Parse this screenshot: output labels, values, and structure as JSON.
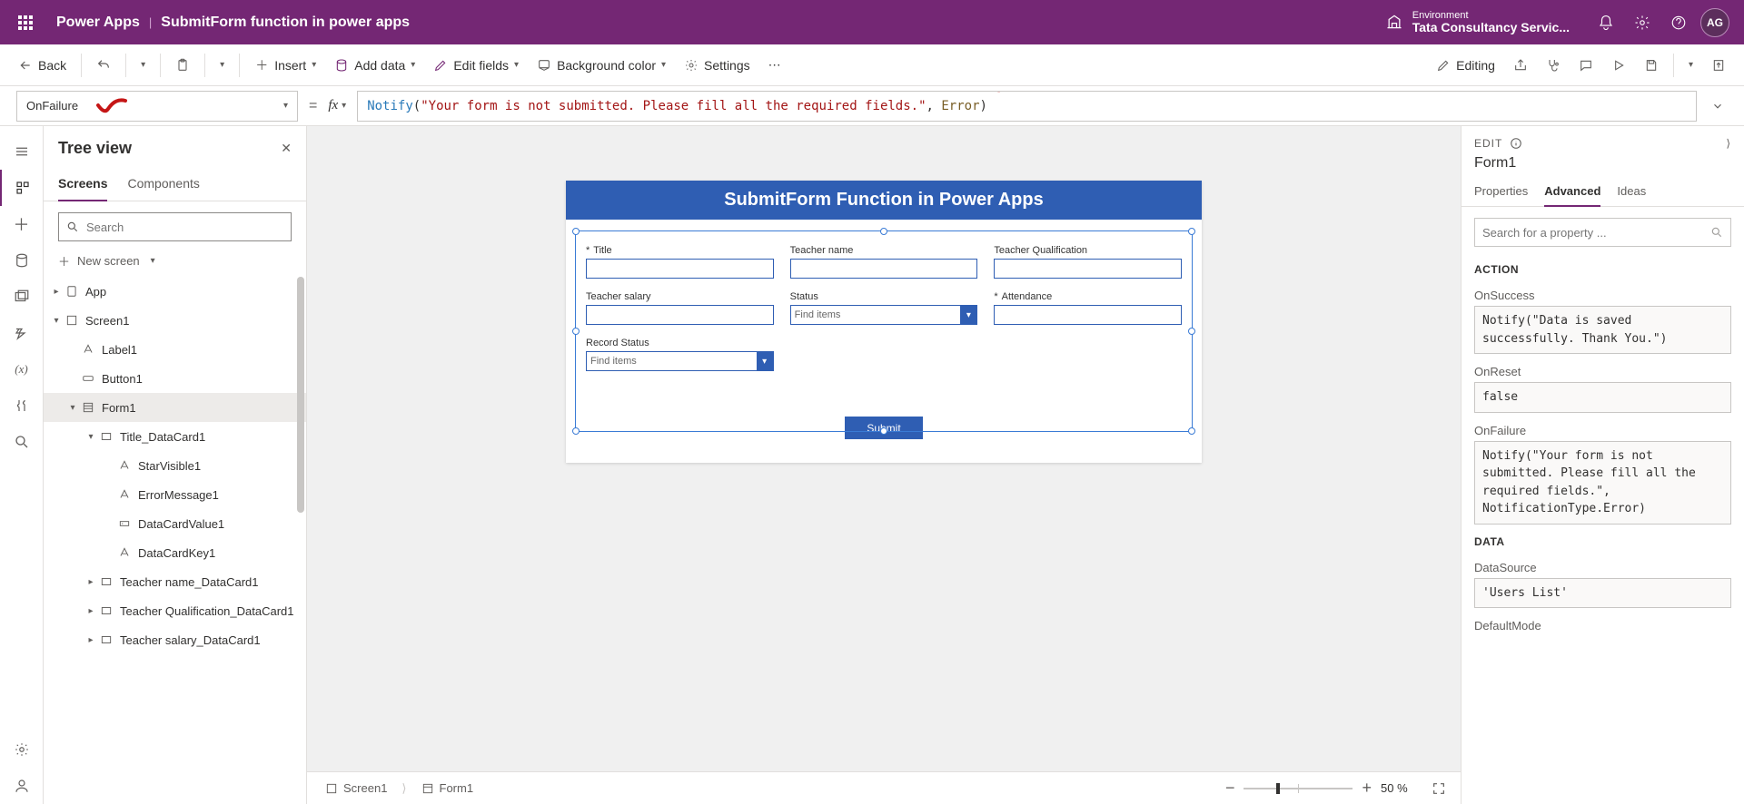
{
  "header": {
    "app": "Power Apps",
    "sep": "|",
    "title": "SubmitForm function in power apps",
    "env_label": "Environment",
    "env_name": "Tata Consultancy Servic...",
    "avatar": "AG"
  },
  "cmdbar": {
    "back": "Back",
    "insert": "Insert",
    "add_data": "Add data",
    "edit_fields": "Edit fields",
    "bg_color": "Background color",
    "settings": "Settings",
    "editing": "Editing"
  },
  "formula": {
    "property": "OnFailure",
    "fn": "Notify",
    "open": "(",
    "str": "\"Your form is not submitted. Please fill all the required fields.\"",
    "comma": ", ",
    "enum": "Error",
    "close": ")"
  },
  "tree": {
    "title": "Tree view",
    "tab_screens": "Screens",
    "tab_components": "Components",
    "search_placeholder": "Search",
    "new_screen": "New screen",
    "items": {
      "app": "App",
      "screen1": "Screen1",
      "label1": "Label1",
      "button1": "Button1",
      "form1": "Form1",
      "title_dc": "Title_DataCard1",
      "starvisible": "StarVisible1",
      "errmsg": "ErrorMessage1",
      "dcval": "DataCardValue1",
      "dckey": "DataCardKey1",
      "teacher_name_dc": "Teacher name_DataCard1",
      "teacher_qual_dc": "Teacher Qualification_DataCard1",
      "teacher_sal_dc": "Teacher salary_DataCard1"
    }
  },
  "canvas": {
    "heading": "SubmitForm Function in Power Apps",
    "fields": {
      "title": "Title",
      "teacher_name": "Teacher name",
      "teacher_qual": "Teacher Qualification",
      "teacher_salary": "Teacher salary",
      "status": "Status",
      "attendance": "Attendance",
      "record_status": "Record Status",
      "find_items": "Find items"
    },
    "submit": "Submit",
    "bc_screen": "Screen1",
    "bc_form": "Form1",
    "zoom": "50  %"
  },
  "props": {
    "edit": "EDIT",
    "name": "Form1",
    "tab_properties": "Properties",
    "tab_advanced": "Advanced",
    "tab_ideas": "Ideas",
    "search_placeholder": "Search for a property ...",
    "section_action": "ACTION",
    "on_success_label": "OnSuccess",
    "on_success_code": "Notify(\"Data is saved successfully. Thank You.\")",
    "on_reset_label": "OnReset",
    "on_reset_code": "false",
    "on_failure_label": "OnFailure",
    "on_failure_code": "Notify(\"Your form is not submitted. Please fill all the required fields.\", NotificationType.Error)",
    "section_data": "DATA",
    "datasource_label": "DataSource",
    "datasource_code": "'Users List'",
    "defaultmode_label": "DefaultMode"
  }
}
